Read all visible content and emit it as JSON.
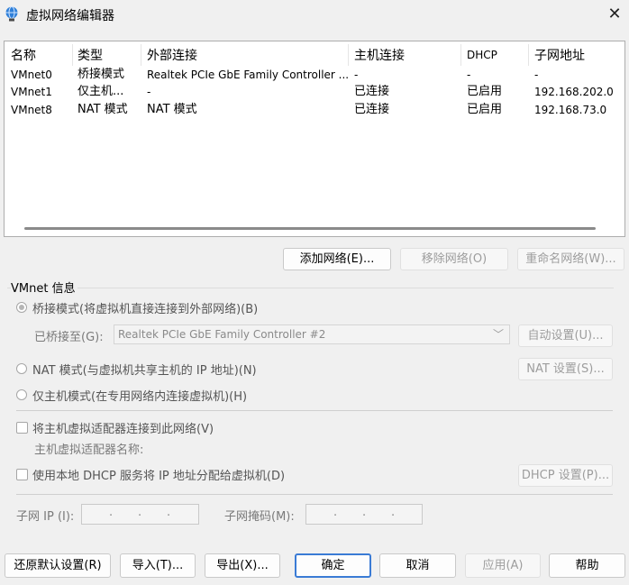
{
  "window": {
    "title": "虚拟网络编辑器",
    "close_label": "✕"
  },
  "list": {
    "headers": [
      "名称",
      "类型",
      "外部连接",
      "主机连接",
      "DHCP",
      "子网地址"
    ],
    "rows": [
      {
        "name": "VMnet0",
        "type": "桥接模式",
        "external": "Realtek PCIe GbE Family Controller ...",
        "host": "-",
        "dhcp": "-",
        "subnet": "-"
      },
      {
        "name": "VMnet1",
        "type": "仅主机...",
        "external": "-",
        "host": "已连接",
        "dhcp": "已启用",
        "subnet": "192.168.202.0"
      },
      {
        "name": "VMnet8",
        "type": "NAT 模式",
        "external": "NAT 模式",
        "host": "已连接",
        "dhcp": "已启用",
        "subnet": "192.168.73.0"
      }
    ]
  },
  "list_buttons": {
    "add": "添加网络(E)...",
    "remove": "移除网络(O)",
    "rename": "重命名网络(W)..."
  },
  "info": {
    "group_title": "VMnet 信息",
    "bridged_label": "桥接模式(将虚拟机直接连接到外部网络)(B)",
    "bridged_to_label": "已桥接至(G):",
    "bridged_to_value": "Realtek PCIe GbE Family Controller #2",
    "auto_settings": "自动设置(U)...",
    "nat_label": "NAT 模式(与虚拟机共享主机的 IP 地址)(N)",
    "nat_settings": "NAT 设置(S)...",
    "hostonly_label": "仅主机模式(在专用网络内连接虚拟机)(H)",
    "connect_adapter_label": "将主机虚拟适配器连接到此网络(V)",
    "adapter_name_label": "主机虚拟适配器名称:",
    "dhcp_label": "使用本地 DHCP 服务将 IP 地址分配给虚拟机(D)",
    "dhcp_settings": "DHCP 设置(P)...",
    "subnet_ip_label": "子网 IP (I):",
    "subnet_mask_label": "子网掩码(M):",
    "ip_dot": "."
  },
  "footer": {
    "restore": "还原默认设置(R)",
    "import": "导入(T)...",
    "export": "导出(X)...",
    "ok": "确定",
    "cancel": "取消",
    "apply": "应用(A)",
    "help": "帮助"
  },
  "colors": {
    "accent": "#3a7bd5",
    "disabled_text": "#9d9d9d"
  }
}
